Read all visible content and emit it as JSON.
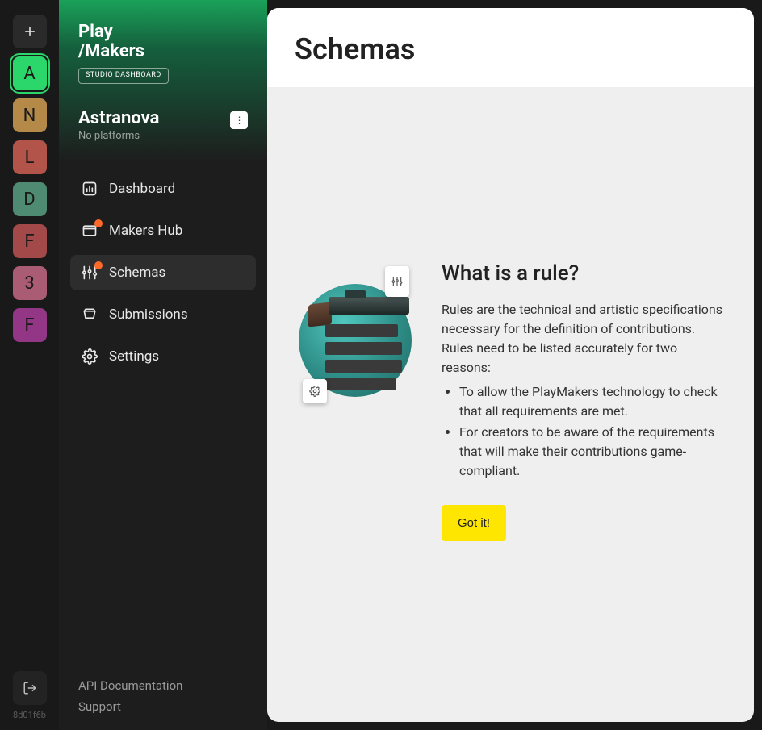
{
  "rail": {
    "tiles": [
      {
        "label": "A",
        "bg": "#2bd66a",
        "active": true
      },
      {
        "label": "N",
        "bg": "#b58a49",
        "active": false
      },
      {
        "label": "L",
        "bg": "#b25449",
        "active": false
      },
      {
        "label": "D",
        "bg": "#4f8a73",
        "active": false
      },
      {
        "label": "F",
        "bg": "#a34949",
        "active": false
      },
      {
        "label": "3",
        "bg": "#aa5c75",
        "active": false
      },
      {
        "label": "F",
        "bg": "#933686",
        "active": false
      }
    ],
    "version": "8d01f6b"
  },
  "brand": {
    "line1": "Play",
    "line2": "/Makers",
    "tag": "STUDIO DASHBOARD"
  },
  "project": {
    "name": "Astranova",
    "sub": "No platforms"
  },
  "nav": [
    {
      "key": "dashboard",
      "label": "Dashboard",
      "icon": "chart-bar-icon",
      "badge": false,
      "active": false
    },
    {
      "key": "makers-hub",
      "label": "Makers Hub",
      "icon": "window-icon",
      "badge": true,
      "active": false
    },
    {
      "key": "schemas",
      "label": "Schemas",
      "icon": "sliders-icon",
      "badge": true,
      "active": true
    },
    {
      "key": "submissions",
      "label": "Submissions",
      "icon": "inbox-icon",
      "badge": false,
      "active": false
    },
    {
      "key": "settings",
      "label": "Settings",
      "icon": "gear-icon",
      "badge": false,
      "active": false
    }
  ],
  "footer_links": {
    "api_docs": "API Documentation",
    "support": "Support"
  },
  "main": {
    "title": "Schemas",
    "panel": {
      "heading": "What is a rule?",
      "description": "Rules are the technical and artistic specifications necessary for the definition of contributions. Rules need to be listed accurately for two reasons:",
      "bullets": [
        "To allow the PlayMakers technology to check that all requirements are met.",
        "For creators to be aware of the requirements that will make their contributions game-compliant."
      ],
      "cta": "Got it!"
    }
  }
}
